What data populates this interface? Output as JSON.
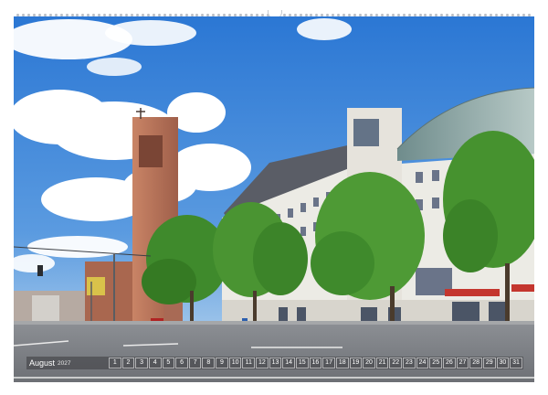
{
  "calendar": {
    "month": "August",
    "year": "2027",
    "days": [
      "1",
      "2",
      "3",
      "4",
      "5",
      "6",
      "7",
      "8",
      "9",
      "10",
      "11",
      "12",
      "13",
      "14",
      "15",
      "16",
      "17",
      "18",
      "19",
      "20",
      "21",
      "22",
      "23",
      "24",
      "25",
      "26",
      "27",
      "28",
      "29",
      "30",
      "31"
    ]
  },
  "colors": {
    "sky": "#2f7fd8",
    "sky_horizon": "#8fbbe6",
    "road": "#7c7f84",
    "brick": "#b9735d",
    "tree": "#3f8a2c",
    "facade": "#ecebe6",
    "strip": "#3a3a3e"
  },
  "icons": {
    "binding": "spiral-binding-icon",
    "hanger": "hanger-notch-icon"
  }
}
